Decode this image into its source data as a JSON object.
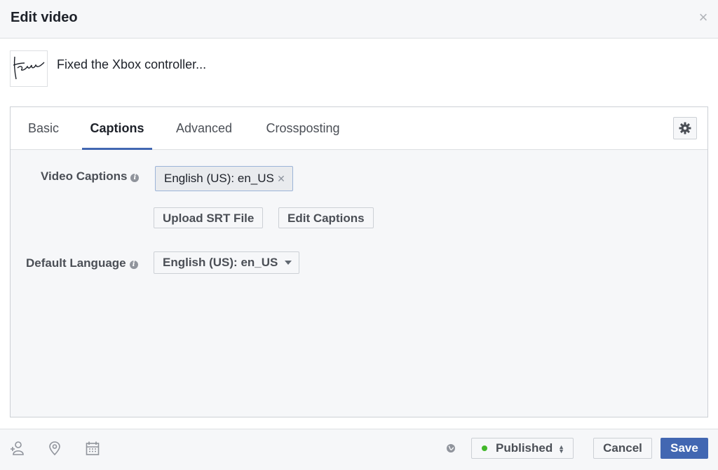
{
  "dialog": {
    "title": "Edit video",
    "close_icon": "close-icon"
  },
  "video": {
    "title": "Fixed the Xbox controller..."
  },
  "tabs": [
    {
      "label": "Basic",
      "active": false
    },
    {
      "label": "Captions",
      "active": true
    },
    {
      "label": "Advanced",
      "active": false
    },
    {
      "label": "Crossposting",
      "active": false
    }
  ],
  "captions": {
    "video_captions_label": "Video Captions",
    "caption_token": "English (US): en_US",
    "upload_button": "Upload SRT File",
    "edit_button": "Edit Captions",
    "default_language_label": "Default Language",
    "default_language_value": "English (US): en_US"
  },
  "footer": {
    "icons": [
      "tag-people-icon",
      "location-icon",
      "calendar-icon"
    ],
    "status": "Published",
    "status_color": "#42b72a",
    "cancel": "Cancel",
    "save": "Save"
  },
  "colors": {
    "accent": "#4267b2",
    "panel_bg": "#f6f7f9"
  }
}
